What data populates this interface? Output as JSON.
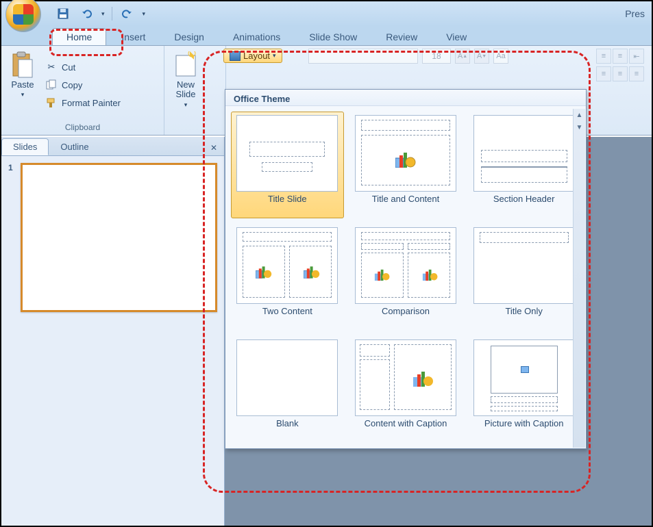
{
  "title_fragment": "Pres",
  "qat": {
    "save": "save",
    "undo": "undo",
    "redo": "redo"
  },
  "tabs": [
    "Home",
    "Insert",
    "Design",
    "Animations",
    "Slide Show",
    "Review",
    "View"
  ],
  "active_tab": "Home",
  "clipboard": {
    "paste": "Paste",
    "cut": "Cut",
    "copy": "Copy",
    "format_painter": "Format Painter",
    "group_label": "Clipboard"
  },
  "slides_group": {
    "new_slide": "New\nSlide",
    "layout_btn": "Layout"
  },
  "font": {
    "size": "18"
  },
  "left_panel": {
    "tabs": [
      "Slides",
      "Outline"
    ],
    "active": "Slides",
    "slide_number": "1"
  },
  "gallery": {
    "header": "Office Theme",
    "items": [
      "Title Slide",
      "Title and Content",
      "Section Header",
      "Two Content",
      "Comparison",
      "Title Only",
      "Blank",
      "Content with Caption",
      "Picture with Caption"
    ],
    "selected_index": 0
  }
}
